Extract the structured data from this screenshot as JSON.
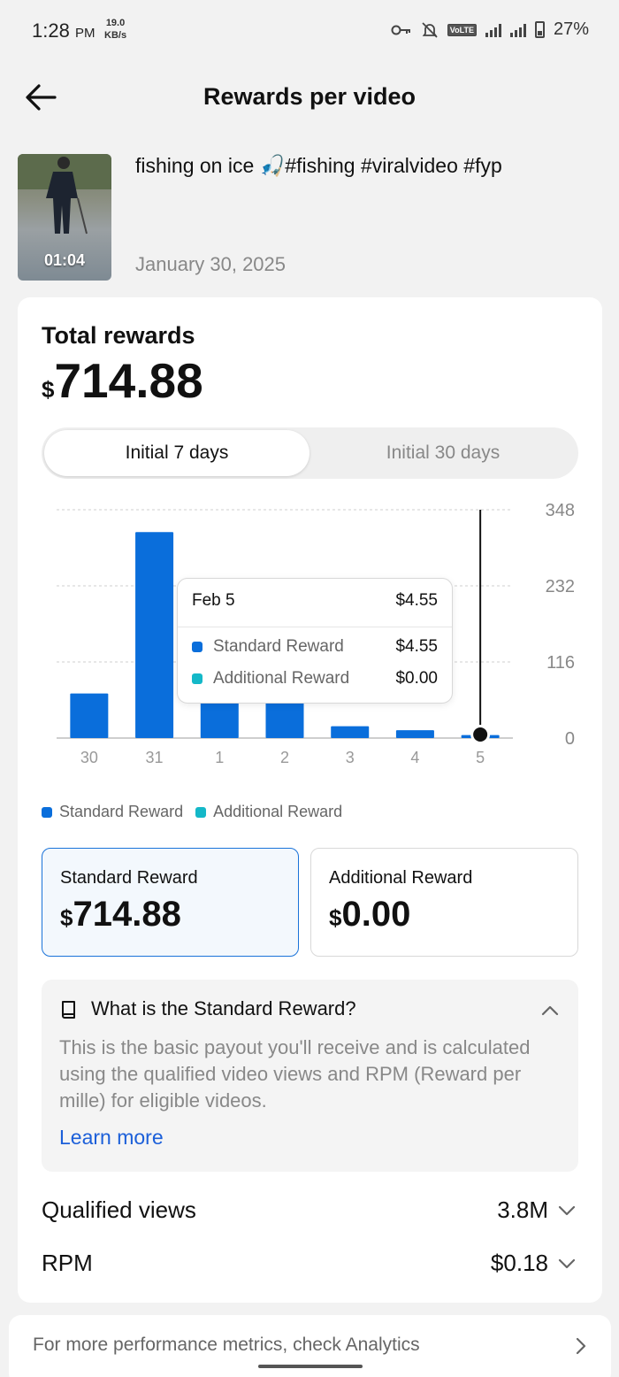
{
  "status_bar": {
    "time": "1:28",
    "ampm": "PM",
    "speed_value": "19.0",
    "speed_unit": "KB/s",
    "battery": "27%"
  },
  "header": {
    "title": "Rewards per video"
  },
  "video": {
    "title": "fishing on ice 🎣#fishing #viralvideo #fyp",
    "duration": "01:04",
    "date": "January 30, 2025"
  },
  "total": {
    "label": "Total rewards",
    "currency": "$",
    "amount": "714.88"
  },
  "tabs": [
    {
      "label": "Initial 7 days",
      "active": true
    },
    {
      "label": "Initial 30 days",
      "active": false
    }
  ],
  "colors": {
    "standard": "#0a6edb",
    "additional": "#14b8c8",
    "accent_link": "#1b5fd9"
  },
  "chart_data": {
    "type": "bar",
    "categories": [
      "30",
      "31",
      "1",
      "2",
      "3",
      "4",
      "5"
    ],
    "series": [
      {
        "name": "Standard Reward",
        "values": [
          68,
          314,
          140,
          160,
          18,
          12,
          4.55
        ]
      },
      {
        "name": "Additional Reward",
        "values": [
          0,
          0,
          0,
          0,
          0,
          0,
          0
        ]
      }
    ],
    "ylim": [
      0,
      348
    ],
    "yticks": [
      "0",
      "116",
      "232",
      "348"
    ],
    "grid": true,
    "selected_index": 6
  },
  "tooltip": {
    "date": "Feb 5",
    "total": "$4.55",
    "rows": [
      {
        "name": "Standard Reward",
        "value": "$4.55"
      },
      {
        "name": "Additional Reward",
        "value": "$0.00"
      }
    ]
  },
  "legend": [
    "Standard Reward",
    "Additional Reward"
  ],
  "reward_boxes": [
    {
      "label": "Standard Reward",
      "currency": "$",
      "value": "714.88"
    },
    {
      "label": "Additional Reward",
      "currency": "$",
      "value": "0.00"
    }
  ],
  "info": {
    "title": "What is the Standard Reward?",
    "body": "This is the basic payout you'll receive and is calculated using the qualified video views and RPM (Reward per mille) for eligible videos.",
    "link": "Learn more"
  },
  "metrics": [
    {
      "label": "Qualified views",
      "value": "3.8M"
    },
    {
      "label": "RPM",
      "value": "$0.18"
    }
  ],
  "bottom": {
    "text": "For more performance metrics, check Analytics"
  }
}
